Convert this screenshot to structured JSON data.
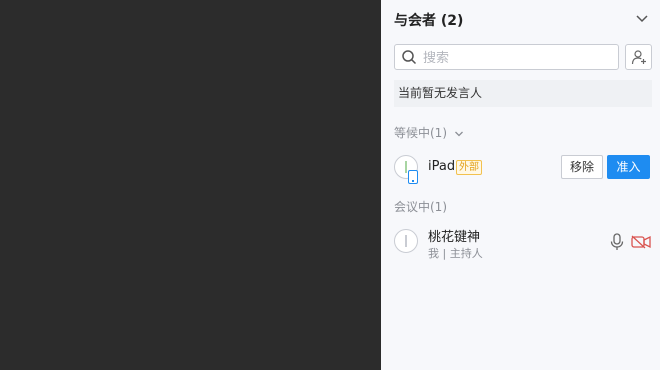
{
  "panel": {
    "title": "与会者 (2)",
    "search": {
      "placeholder": "搜索"
    },
    "speaker_status": "当前暂无发言人",
    "waiting": {
      "label": "等候中(1)",
      "members": [
        {
          "name": "iPad",
          "tag": "外部",
          "remove_label": "移除",
          "admit_label": "准入"
        }
      ]
    },
    "in_meeting": {
      "label": "会议中(1)",
      "members": [
        {
          "name": "桃花键神",
          "role": "我 | 主持人"
        }
      ]
    }
  },
  "colors": {
    "accent": "#1e8cf1",
    "external_tag": "#e3a21b",
    "camera_off": "#d9534f"
  },
  "icons": [
    "chevron-down-icon",
    "search-icon",
    "add-user-icon",
    "tablet-icon",
    "microphone-icon",
    "camera-off-icon"
  ]
}
